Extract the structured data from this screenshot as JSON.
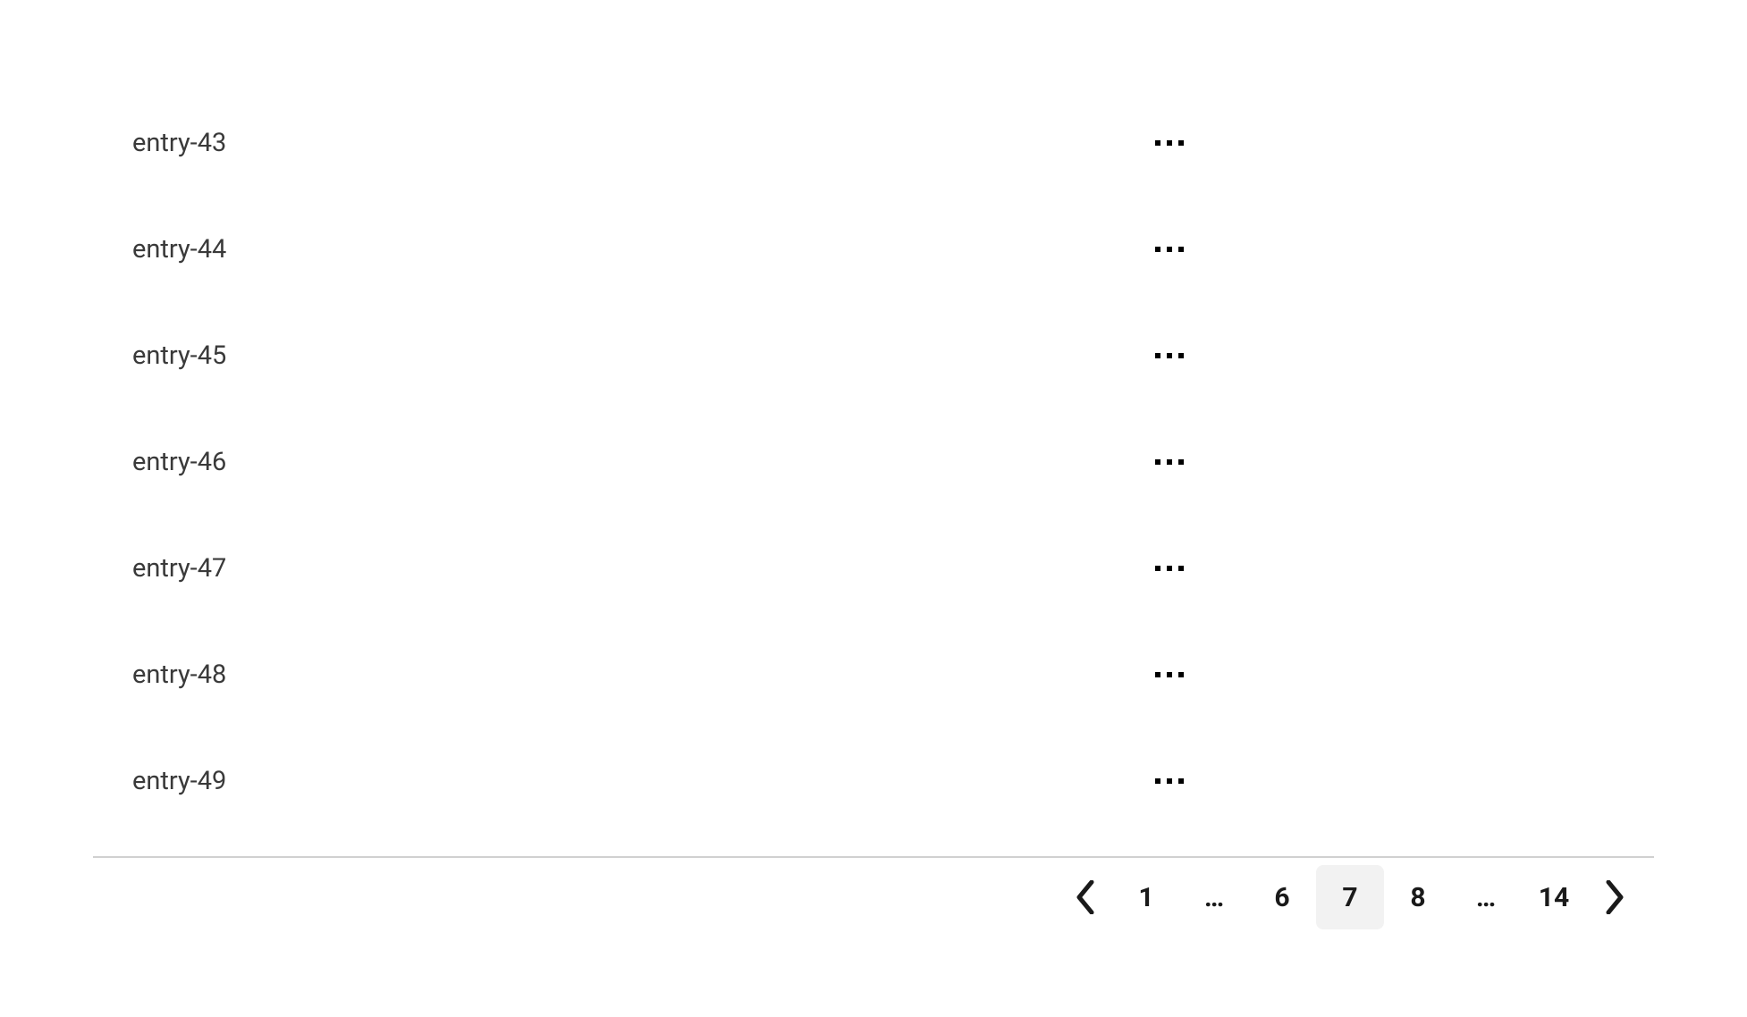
{
  "list": {
    "items": [
      {
        "label": "entry-43"
      },
      {
        "label": "entry-44"
      },
      {
        "label": "entry-45"
      },
      {
        "label": "entry-46"
      },
      {
        "label": "entry-47"
      },
      {
        "label": "entry-48"
      },
      {
        "label": "entry-49"
      }
    ]
  },
  "pagination": {
    "first": "1",
    "prev_group_ellipsis": "…",
    "prev_page": "6",
    "current_page": "7",
    "next_page": "8",
    "next_group_ellipsis": "…",
    "last": "14"
  }
}
